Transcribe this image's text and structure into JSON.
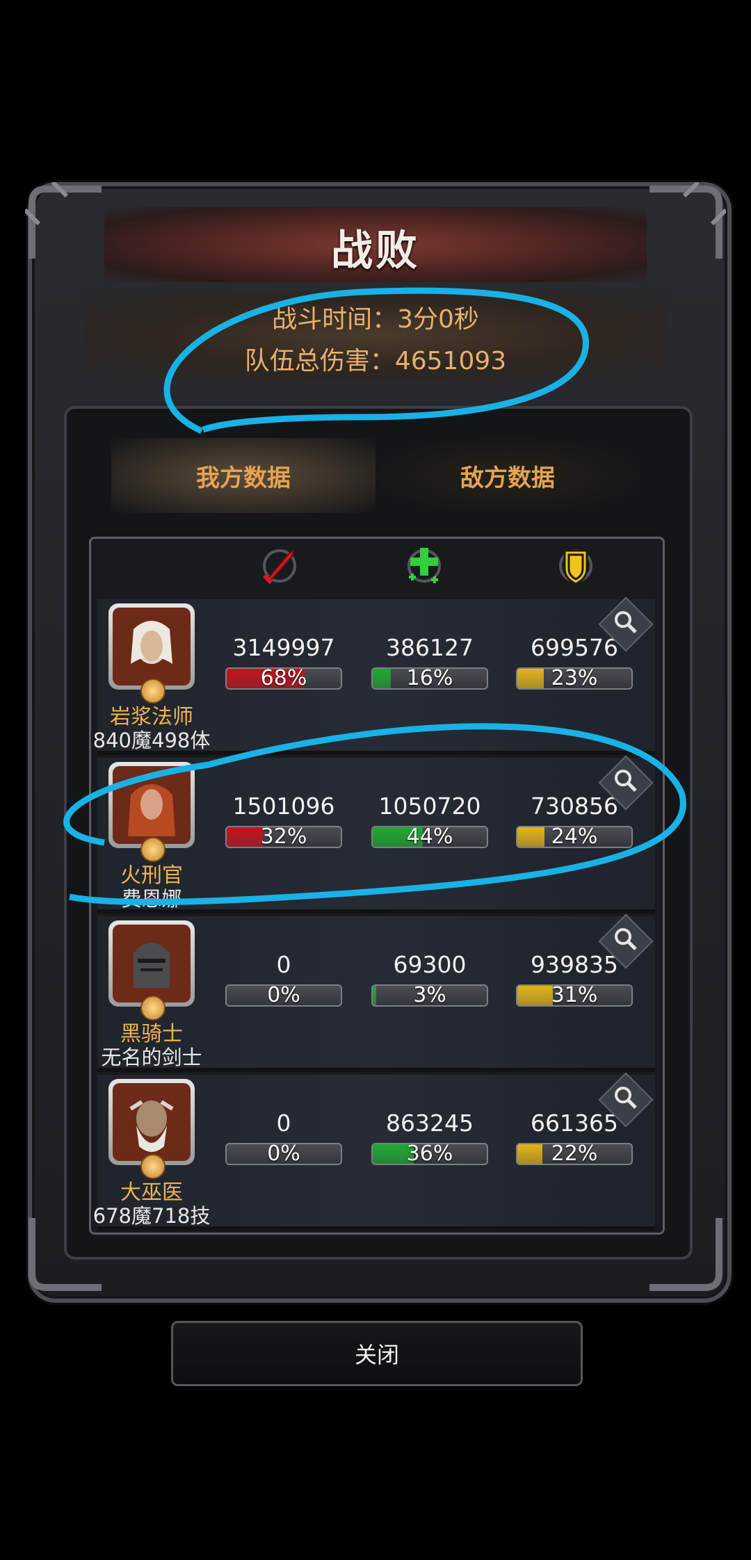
{
  "title": "战败",
  "info": {
    "battle_time": "战斗时间：3分0秒",
    "team_damage": "队伍总伤害：4651093"
  },
  "tabs": [
    "我方数据",
    "敌方数据"
  ],
  "stat_icons": [
    "sword-icon",
    "heal-cross-icon",
    "shield-icon"
  ],
  "colors": {
    "damage": "#c4121c",
    "heal": "#1ea832",
    "tank": "#e2b41a",
    "accent": "#f0b34e"
  },
  "rows": [
    {
      "name": "岩浆法师",
      "sub": "840魔498体",
      "damage": "3149997",
      "damage_pct": "68%",
      "damage_frac": 0.68,
      "heal": "386127",
      "heal_pct": "16%",
      "heal_frac": 0.16,
      "tank": "699576",
      "tank_pct": "23%",
      "tank_frac": 0.23
    },
    {
      "name": "火刑官",
      "sub": "费恩娜",
      "damage": "1501096",
      "damage_pct": "32%",
      "damage_frac": 0.32,
      "heal": "1050720",
      "heal_pct": "44%",
      "heal_frac": 0.44,
      "tank": "730856",
      "tank_pct": "24%",
      "tank_frac": 0.24
    },
    {
      "name": "黑骑士",
      "sub": "无名的剑士",
      "damage": "0",
      "damage_pct": "0%",
      "damage_frac": 0,
      "heal": "69300",
      "heal_pct": "3%",
      "heal_frac": 0.03,
      "tank": "939835",
      "tank_pct": "31%",
      "tank_frac": 0.31
    },
    {
      "name": "大巫医",
      "sub": "678魔718技",
      "damage": "0",
      "damage_pct": "0%",
      "damage_frac": 0,
      "heal": "863245",
      "heal_pct": "36%",
      "heal_frac": 0.36,
      "tank": "661365",
      "tank_pct": "22%",
      "tank_frac": 0.22
    }
  ],
  "close_label": "关闭"
}
